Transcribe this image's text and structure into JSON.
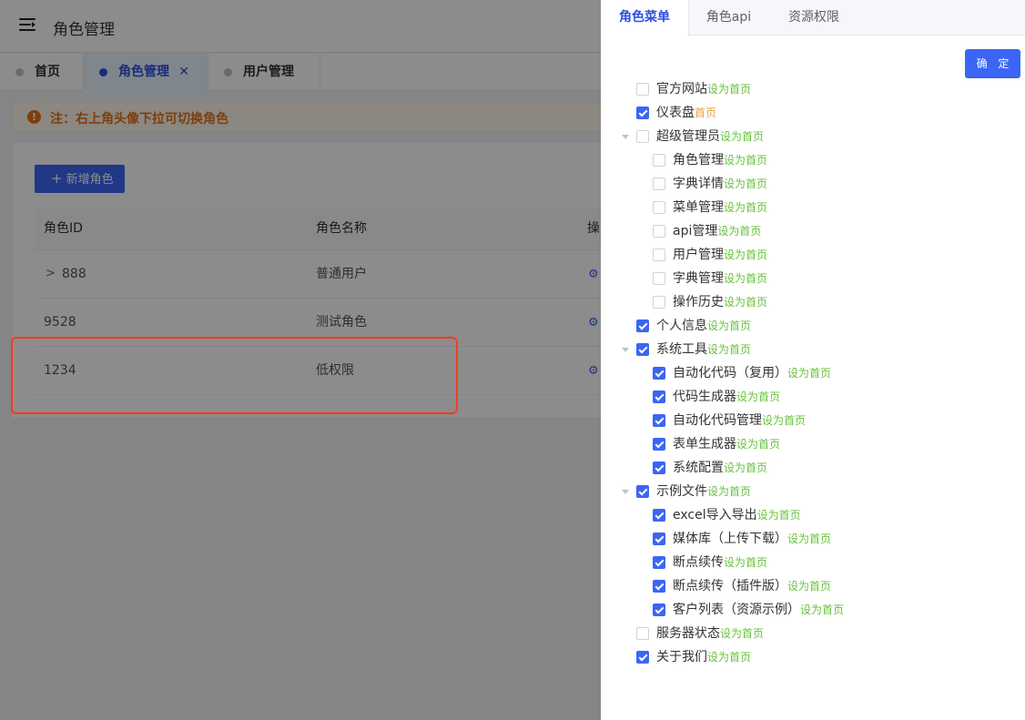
{
  "header": {
    "title": "角色管理"
  },
  "tabs": [
    {
      "label": "首页"
    },
    {
      "label": "角色管理",
      "close": "✕"
    },
    {
      "label": "用户管理"
    }
  ],
  "notice": {
    "icon": "!",
    "text": "注：右上角头像下拉可切换角色"
  },
  "toolbar": {
    "add_label": "新增角色",
    "add_icon": "+"
  },
  "table": {
    "headers": [
      "角色ID",
      "角色名称",
      "操"
    ],
    "rows": [
      {
        "id": "888",
        "name": "普通用户",
        "expandable": true
      },
      {
        "id": "9528",
        "name": "测试角色",
        "expandable": false
      },
      {
        "id": "1234",
        "name": "低权限",
        "expandable": false
      }
    ]
  },
  "drawer": {
    "tabs": [
      "角色菜单",
      "角色api",
      "资源权限"
    ],
    "confirm_label": "确 定",
    "set_home_label": "设为首页",
    "home_label": "首页",
    "tree": [
      {
        "label": "官方网站",
        "checked": false,
        "home": false
      },
      {
        "label": "仪表盘",
        "checked": true,
        "home": true
      },
      {
        "label": "超级管理员",
        "checked": false,
        "home": false,
        "expanded": true,
        "children": [
          {
            "label": "角色管理",
            "checked": false
          },
          {
            "label": "字典详情",
            "checked": false
          },
          {
            "label": "菜单管理",
            "checked": false
          },
          {
            "label": "api管理",
            "checked": false
          },
          {
            "label": "用户管理",
            "checked": false
          },
          {
            "label": "字典管理",
            "checked": false
          },
          {
            "label": "操作历史",
            "checked": false
          }
        ]
      },
      {
        "label": "个人信息",
        "checked": true,
        "home": false
      },
      {
        "label": "系统工具",
        "checked": true,
        "home": false,
        "expanded": true,
        "children": [
          {
            "label": "自动化代码（复用）",
            "checked": true
          },
          {
            "label": "代码生成器",
            "checked": true
          },
          {
            "label": "自动化代码管理",
            "checked": true
          },
          {
            "label": "表单生成器",
            "checked": true
          },
          {
            "label": "系统配置",
            "checked": true
          }
        ]
      },
      {
        "label": "示例文件",
        "checked": true,
        "home": false,
        "expanded": true,
        "children": [
          {
            "label": "excel导入导出",
            "checked": true
          },
          {
            "label": "媒体库（上传下载）",
            "checked": true
          },
          {
            "label": "断点续传",
            "checked": true
          },
          {
            "label": "断点续传（插件版）",
            "checked": true
          },
          {
            "label": "客户列表（资源示例）",
            "checked": true
          }
        ]
      },
      {
        "label": "服务器状态",
        "checked": false,
        "home": false
      },
      {
        "label": "关于我们",
        "checked": true,
        "home": false
      }
    ]
  },
  "colors": {
    "primary": "#3b66f5",
    "warning": "#e6711a",
    "set_home": "#67c23a",
    "current_home": "#e6a23c",
    "highlight": "#ff3a1d"
  }
}
